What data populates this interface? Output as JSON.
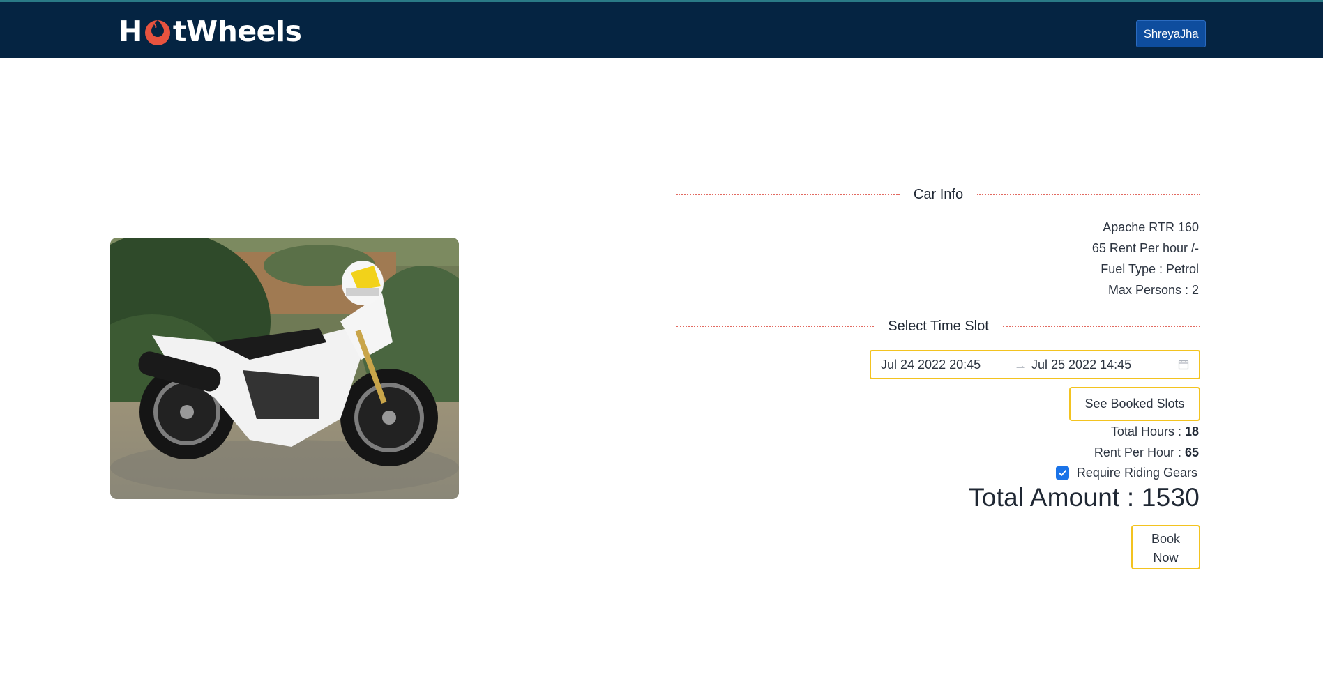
{
  "header": {
    "brand_prefix": "H",
    "brand_suffix": "tWheels",
    "user_name": "ShreyaJha",
    "colors": {
      "navbar": "#052442",
      "brand_mark": "#e8533f",
      "user_button": "#0e4d9e"
    }
  },
  "vehicle_image": {
    "alt": "White motorcycle with helmet",
    "icon": "motorcycle-photo"
  },
  "car_info": {
    "heading": "Car Info",
    "name": "Apache RTR 160",
    "rent_line": "65 Rent Per hour /-",
    "fuel_line": "Fuel Type : Petrol",
    "persons_line": "Max Persons : 2"
  },
  "time_slot": {
    "heading": "Select Time Slot",
    "start": "Jul 24 2022 20:45",
    "end": "Jul 25 2022 14:45",
    "arrow_icon": "range-arrow-icon",
    "calendar_icon": "calendar-icon",
    "see_booked_label": "See Booked Slots"
  },
  "summary": {
    "total_hours_label": "Total Hours : ",
    "total_hours_value": "18",
    "rent_per_hour_label": "Rent Per Hour : ",
    "rent_per_hour_value": "65",
    "riding_gears_label": "Require Riding Gears",
    "riding_gears_checked": true,
    "total_amount": "Total Amount : 1530",
    "book_now_line1": "Book",
    "book_now_line2": "Now"
  },
  "colors": {
    "accent_border": "#f3c320",
    "divider": "#e26a61",
    "checkbox": "#1a73e8"
  }
}
